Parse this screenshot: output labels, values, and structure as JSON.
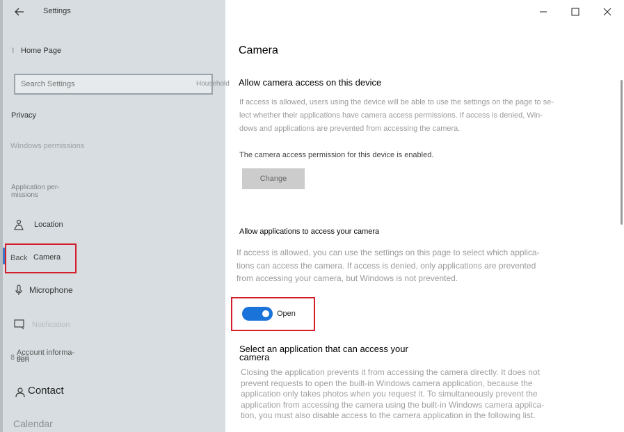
{
  "window": {
    "title": "Settings",
    "minimize_label": "minimize",
    "maximize_label": "maximize",
    "close_label": "close"
  },
  "sidebar": {
    "home_link": "Home Page",
    "search_placeholder": "Search Settings",
    "household": "Household",
    "section_privacy": "Privacy",
    "section_windows_permissions": "Windows permissions",
    "section_app_permissions": "Application per- missions",
    "items": [
      {
        "label": "Location",
        "icon": "location-icon"
      },
      {
        "label": "Camera",
        "icon": "camera-icon",
        "prefix": "Back"
      },
      {
        "label": "Microphone",
        "icon": "microphone-icon"
      },
      {
        "label": "Notification",
        "icon": "notification-icon"
      },
      {
        "label": "Account informa- tion",
        "icon": "account-icon",
        "prefix": "8 ase"
      },
      {
        "label": "Contact",
        "icon": "contact-icon"
      },
      {
        "label": "Calendar",
        "icon": "calendar-icon"
      }
    ]
  },
  "main": {
    "title": "Camera",
    "device_heading": "Allow camera access on this device",
    "device_desc": "If access is allowed, users using the device will be able to use the settings on the page to se- lect whether their applications have camera access permissions. If access is denied, Win- dows and applications are prevented from accessing the camera.",
    "device_status": "The camera access permission for this device is enabled.",
    "change_button": "Change",
    "apps_heading": "Allow applications to access your camera",
    "apps_desc": "If access is allowed, you can use the settings on this page to select which applica- tions can access the camera. If access is denied, only applications are prevented from accessing your camera, but Windows is not prevented.",
    "toggle_state": "Open",
    "select_heading": "Select an application that can access your camera",
    "select_desc": "Closing the application prevents it from accessing the camera directly. It does not prevent requests to open the built-in Windows camera application, because the application only takes photos when you request it. To simultaneously prevent the application from accessing the camera using the built-in Windows camera applica- tion, you must also disable access to the camera application in the following list."
  },
  "colors": {
    "accent": "#1a73d9",
    "highlight": "#d21f2b",
    "sidebar_bg": "#d7dde0"
  }
}
